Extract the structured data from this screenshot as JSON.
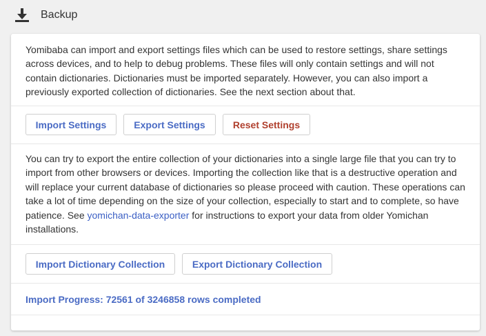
{
  "header": {
    "title": "Backup",
    "icon": "download-icon"
  },
  "settings": {
    "description": "Yomibaba can import and export settings files which can be used to restore settings, share settings across devices, and to help to debug problems. These files will only contain settings and will not contain dictionaries. Dictionaries must be imported separately. However, you can also import a previously exported collection of dictionaries. See the next section about that.",
    "import_label": "Import Settings",
    "export_label": "Export Settings",
    "reset_label": "Reset Settings"
  },
  "collection": {
    "description_before": "You can try to export the entire collection of your dictionaries into a single large file that you can try to import from other browsers or devices. Importing the collection like that is a destructive operation and will replace your current database of dictionaries so please proceed with caution. These operations can take a lot of time depending on the size of your collection, especially to start and to complete, so have patience. See ",
    "link_text": "yomichan-data-exporter",
    "description_after": " for instructions to export your data from older Yomichan installations.",
    "import_label": "Import Dictionary Collection",
    "export_label": "Export Dictionary Collection"
  },
  "progress": {
    "text": "Import Progress: 72561 of 3246858 rows completed"
  },
  "colors": {
    "accent": "#4a6bc4",
    "danger": "#b0402e",
    "link": "#3b5fc4",
    "background": "#f0f0f0",
    "card": "#ffffff"
  }
}
